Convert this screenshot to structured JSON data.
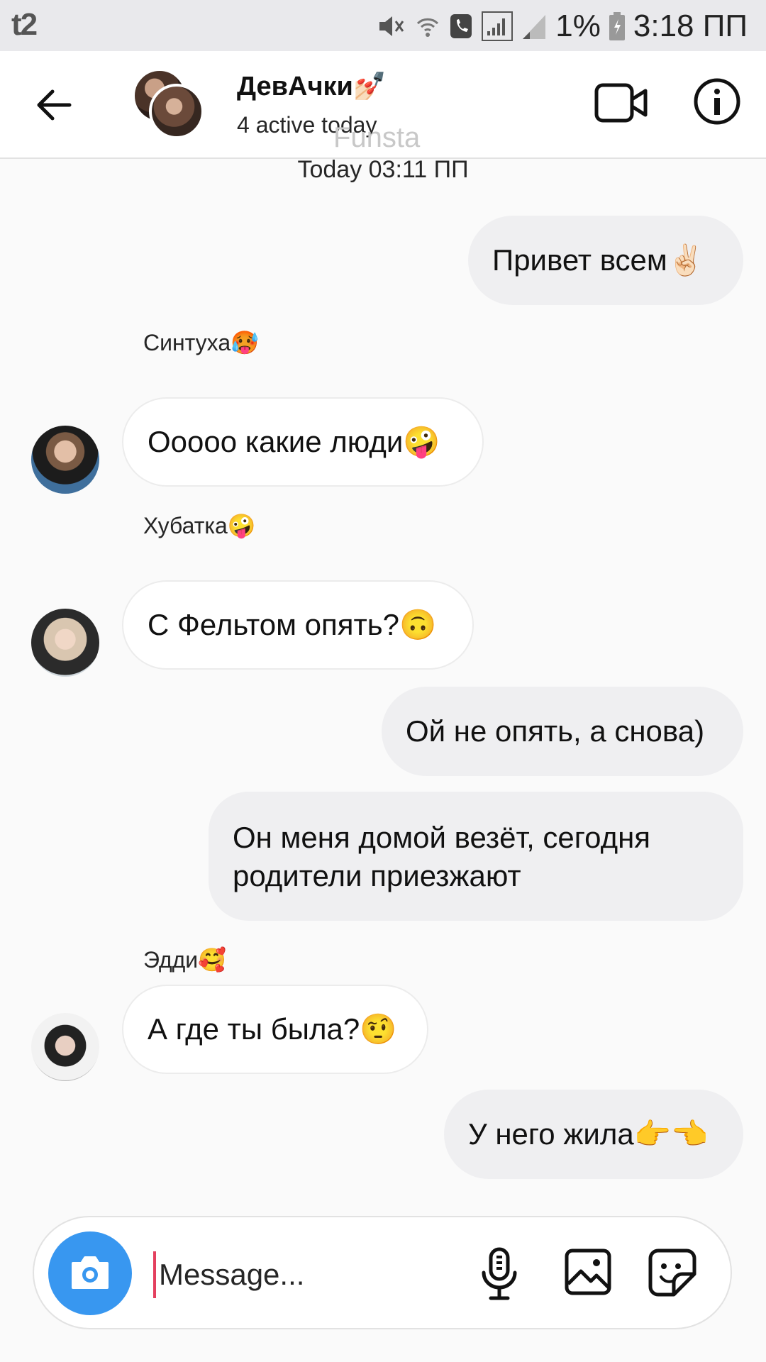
{
  "status_bar": {
    "carrier": "t2",
    "battery": "1%",
    "time": "3:18 ПП"
  },
  "header": {
    "title": "ДевАчки",
    "title_emoji": "💅🏻",
    "subtitle": "4 active today",
    "watermark": "Funsta",
    "icons": [
      "back-arrow-icon",
      "video-call-icon",
      "info-icon"
    ]
  },
  "chat": {
    "timestamp": "Today 03:11 ПП",
    "messages": [
      {
        "direction": "out",
        "text": "Привет всем",
        "emoji": "✌🏻"
      },
      {
        "direction": "in",
        "sender": "Синтуха",
        "sender_emoji": "🥵",
        "text": "Ооооо какие люди",
        "emoji": "🤪"
      },
      {
        "direction": "in",
        "sender": "Хубатка",
        "sender_emoji": "🤪",
        "text": "С Фельтом опять?",
        "emoji": "🙃"
      },
      {
        "direction": "out",
        "text": "Ой не опять, а снова)",
        "emoji": ""
      },
      {
        "direction": "out",
        "text_line1": "Он меня домой везёт, сегодня",
        "text_line2": "родители приезжают"
      },
      {
        "direction": "in",
        "sender": "Эдди",
        "sender_emoji": "🥰",
        "text": "А где ты была?",
        "emoji": "🤨"
      },
      {
        "direction": "out",
        "text": "У него жила",
        "emoji": "👉👈"
      }
    ]
  },
  "composer": {
    "placeholder": "Message...",
    "icons": [
      "camera-icon",
      "microphone-icon",
      "gallery-icon",
      "sticker-icon"
    ]
  },
  "colors": {
    "accent": "#3897f0",
    "outgoing_bubble": "#efeff1",
    "cursor": "#e4405f"
  }
}
